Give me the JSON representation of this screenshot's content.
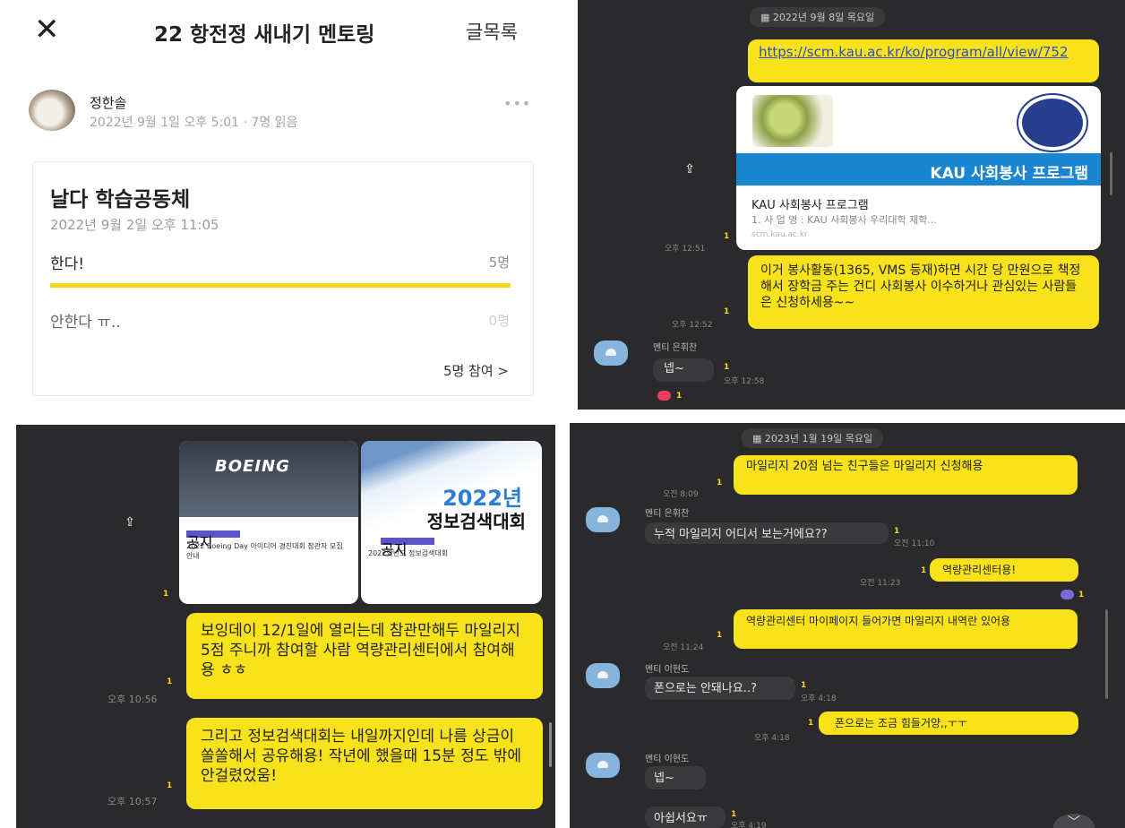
{
  "post": {
    "title": "22 항전정 새내기 멘토링",
    "list_button": "글목록",
    "author": "정한솔",
    "meta": "2022년 9월 1일 오후 5:01 · 7명 읽음",
    "poll": {
      "title": "날다 학습공동체",
      "date": "2022년 9월 2일 오후 11:05",
      "options": [
        {
          "label": "한다!",
          "count": "5명",
          "fraction": 1.0
        },
        {
          "label": "안한다 ㅠ..",
          "count": "0명",
          "fraction": 0.0
        }
      ],
      "participants": "5명 참여 >"
    }
  },
  "chat1": {
    "date": "2022년 9월 8일 목요일",
    "link": "https://scm.kau.ac.kr/ko/program/all/view/752",
    "preview": {
      "banner": "KAU 사회봉사 프로그램",
      "title": "KAU 사회봉사 프로그램",
      "desc": "1. 사 업 명 : KAU 사회봉사 우리대학 재학...",
      "url": "scm.kau.ac.kr"
    },
    "time1": "오후 12:51",
    "message": "이거 봉사활동(1365, VMS 등재)하면 시간 당 만원으로 책정해서 장학금 주는 건디 사회봉사 이수하거나 관심있는 사람들은 신청하세용~~",
    "time2": "오후 12:52",
    "sender": "멘티 은휘찬",
    "reply": "넵~",
    "reply_time": "오후 12:58",
    "unread": "1",
    "reaction_count": "1"
  },
  "chat2": {
    "card1": {
      "brand": "BOEING",
      "title": "2022 Boeing Day 아이디어 경진대회 참관자 모집 안내",
      "badge": "공지"
    },
    "card2": {
      "year": "2022년",
      "big": "정보검색대회",
      "title": "2022학년도 정보검색대회",
      "badge": "공지"
    },
    "message1": "보잉데이 12/1일에 열리는데 참관만해두 마일리지 5점 주니까 참여할 사람 역량관리센터에서 참여해용 ㅎㅎ",
    "time1": "오후 10:56",
    "message2": "그리고 정보검색대회는 내일까지인데 나름 상금이 쏠쏠해서 공유해용! 작년에 했을때 15분 정도 밖에 안걸렸었움!",
    "time2": "오후 10:57",
    "unread": "1"
  },
  "chat3": {
    "date": "2023년 1월 19일 목요일",
    "m1": "마일리지 20점 넘는 친구들은 마일리지 신청해용",
    "t1": "오전 8:09",
    "sender1": "멘티 은휘찬",
    "m2": "누적 마일리지 어디서 보는거에요??",
    "t2": "오전 11:10",
    "m3": "역량관리센터용!",
    "t3": "오전 11:23",
    "m4": "역량관리센터 마이페이지 들어가면 마일리지 내역란 있어용",
    "t4": "오전 11:24",
    "sender2": "멘티 이현도",
    "m5": "폰으로는 안돼나요..?",
    "t5": "오후 4:18",
    "m6": "폰으로는 조금 힘들거양,,ㅜㅜ",
    "t6": "오후 4:18",
    "sender3": "멘티 이현도",
    "m7": "넵~",
    "m8": "아쉽서요ㅠ",
    "t8": "오후 4:19",
    "unread": "1"
  }
}
